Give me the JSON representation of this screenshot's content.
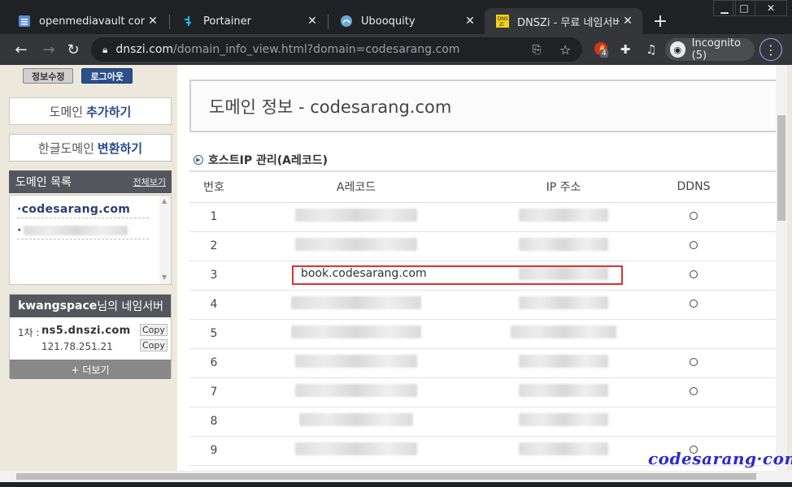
{
  "tabs": [
    {
      "title": "openmediavault control",
      "icon": "omv-icon"
    },
    {
      "title": "Portainer",
      "icon": "portainer-icon"
    },
    {
      "title": "Ubooquity",
      "icon": "ubooquity-icon"
    },
    {
      "title": "DNSZi - 무료 네임서버(d",
      "icon": "dnszi-icon"
    }
  ],
  "url": {
    "host": "dnszi.com",
    "path": "/domain_info_view.html?domain=codesarang.com"
  },
  "incognito": {
    "label": "Incognito (5)"
  },
  "extension_badge": "4",
  "left": {
    "edit_info": "정보수정",
    "logout": "로그아웃",
    "add_domain_prefix": "도메인",
    "add_domain_action": "추가하기",
    "convert_prefix": "한글도메인",
    "convert_action": "변환하기",
    "domain_list_title": "도메인 목록",
    "view_all": "전체보기",
    "domains": [
      "·codesarang.com",
      "·"
    ],
    "ns_user": "kwangspace",
    "ns_suffix": "님의 네임서버",
    "ns_primary_label": "1차 :",
    "ns_primary_host": "ns5.dnszi.com",
    "ns_primary_ip": "121.78.251.21",
    "copy": "Copy",
    "more": "+ 더보기"
  },
  "main": {
    "title": "도메인 정보 - codesarang.com",
    "section": "호스트IP 관리(A레코드)",
    "columns": [
      "번호",
      "A레코드",
      "IP 주소",
      "DDNS"
    ],
    "rows": [
      {
        "num": "1",
        "ddns": true
      },
      {
        "num": "2",
        "ddns": true
      },
      {
        "num": "3",
        "ddns": true
      },
      {
        "num": "4",
        "ddns": true
      },
      {
        "num": "5",
        "ddns": false
      },
      {
        "num": "6",
        "ddns": true
      },
      {
        "num": "7",
        "ddns": true
      },
      {
        "num": "8",
        "ddns": false
      },
      {
        "num": "9",
        "ddns": true
      }
    ],
    "highlight_record": "book.codesarang.com"
  },
  "watermark": "codesarang·com",
  "colors": {
    "accent": "#2a4c88",
    "highlight": "#e03030",
    "panel": "#53575d"
  }
}
